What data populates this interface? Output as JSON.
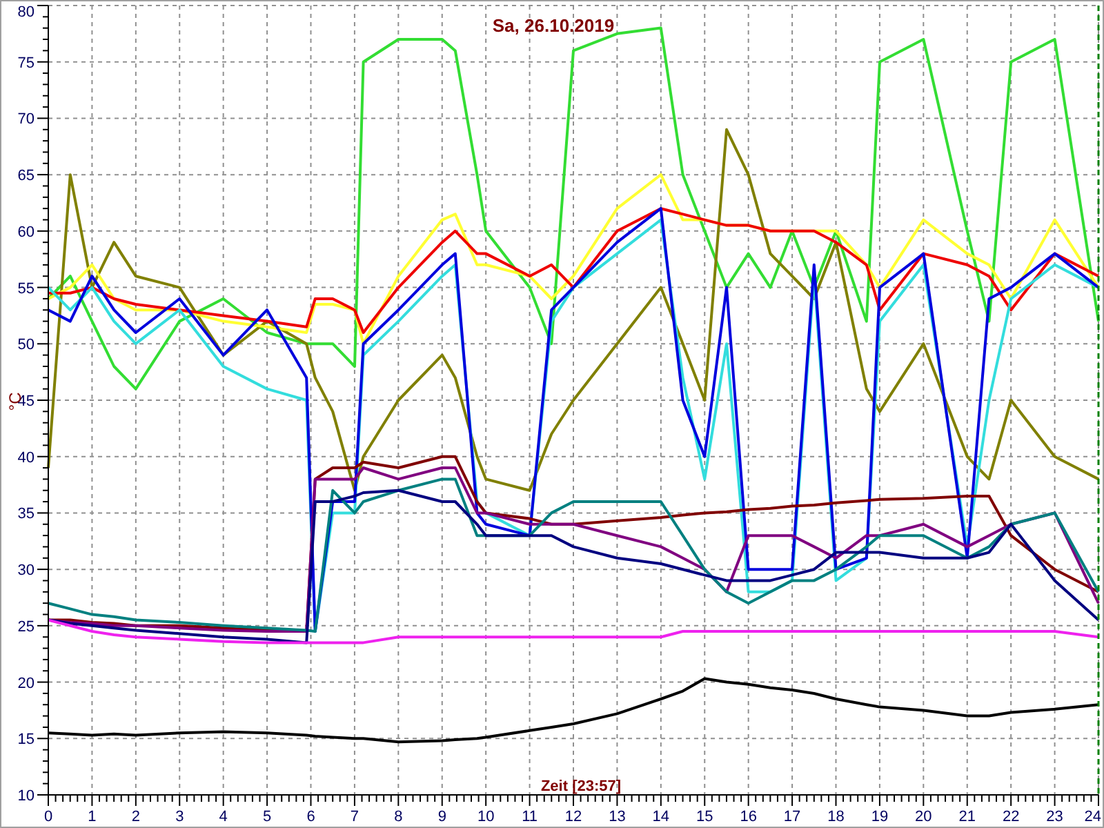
{
  "chart": {
    "chart_data": {
      "type": "line",
      "title": "Sa, 26.10.2019",
      "xlabel": "Zeit [23:57]",
      "ylabel": "°C",
      "x": [
        0,
        0.5,
        1,
        1.5,
        2,
        3,
        4,
        5,
        5.9,
        6.1,
        6.5,
        7,
        7.2,
        8,
        9,
        9.3,
        9.8,
        10,
        11,
        11.5,
        12,
        13,
        14,
        14.5,
        15,
        15.5,
        16,
        16.5,
        17,
        17.5,
        18,
        18.7,
        19,
        20,
        21,
        21.5,
        22,
        23,
        24
      ],
      "grid": true,
      "xlim": [
        0,
        24
      ],
      "ylim": [
        10,
        80
      ],
      "xticks": [
        0,
        1,
        2,
        3,
        4,
        5,
        6,
        7,
        8,
        9,
        10,
        11,
        12,
        13,
        14,
        15,
        16,
        17,
        18,
        19,
        20,
        21,
        22,
        23,
        24
      ],
      "yticks": [
        10,
        15,
        20,
        25,
        30,
        35,
        40,
        45,
        50,
        55,
        60,
        65,
        70,
        75,
        80
      ],
      "series": [
        {
          "color": "#33dd33",
          "values": [
            54,
            56,
            52,
            48,
            46,
            52,
            54,
            51,
            50,
            50,
            50,
            48,
            75,
            77,
            77,
            76,
            65,
            60,
            55,
            50,
            76,
            77.5,
            78,
            65,
            60,
            55,
            58,
            55,
            60,
            55,
            60,
            52,
            75,
            77,
            60,
            52,
            75,
            77,
            52
          ]
        },
        {
          "color": "#808000",
          "values": [
            39,
            65,
            55,
            59,
            56,
            55,
            49,
            52,
            50,
            47,
            44,
            37,
            40,
            45,
            49,
            47,
            40,
            38,
            37,
            42,
            45,
            50,
            55,
            50,
            45,
            69,
            65,
            58,
            56,
            54,
            59,
            46,
            44,
            50,
            40,
            38,
            45,
            40,
            38
          ]
        },
        {
          "color": "#ffff33",
          "values": [
            54,
            55,
            57,
            54,
            53,
            53,
            52,
            51.5,
            51,
            53.5,
            53.5,
            53,
            50,
            56,
            61,
            61.5,
            57,
            57,
            56,
            54,
            56,
            62,
            65,
            61,
            61,
            60.5,
            60.5,
            60,
            60,
            60,
            60,
            57,
            55,
            61,
            58,
            57,
            54,
            61,
            55
          ]
        },
        {
          "color": "#ee0000",
          "values": [
            54.5,
            54.5,
            55,
            54,
            53.5,
            53,
            52.5,
            52,
            51.5,
            54,
            54,
            53,
            51,
            55,
            59,
            60,
            58,
            58,
            56,
            57,
            55,
            60,
            62,
            61.5,
            61,
            60.5,
            60.5,
            60,
            60,
            60,
            59,
            57,
            53,
            58,
            57,
            56,
            53,
            58,
            56
          ]
        },
        {
          "color": "#33dddd",
          "values": [
            55,
            53,
            55,
            52,
            50,
            53,
            48,
            46,
            45,
            24.5,
            35,
            35,
            49,
            52,
            56,
            57,
            36,
            35,
            33,
            52,
            55,
            58,
            61,
            47,
            38,
            50,
            28,
            28,
            29,
            56,
            29,
            31,
            52,
            57,
            32,
            45,
            54,
            57,
            55
          ]
        },
        {
          "color": "#0000dd",
          "values": [
            53,
            52,
            56,
            53,
            51,
            54,
            49,
            53,
            47,
            24.5,
            36,
            36,
            50,
            53,
            57,
            58,
            35,
            34,
            33,
            53,
            55,
            59,
            62,
            45,
            40,
            55,
            30,
            30,
            30,
            57,
            30,
            31,
            55,
            58,
            31,
            54,
            55,
            58,
            55
          ]
        },
        {
          "color": "#800000",
          "values": [
            25.5,
            25.5,
            25.3,
            25.2,
            25,
            25,
            24.8,
            24.6,
            24.5,
            38,
            39,
            39,
            39.5,
            39,
            40,
            40,
            36,
            35,
            34.5,
            34,
            34,
            34.3,
            34.6,
            34.8,
            35,
            35.1,
            35.3,
            35.4,
            35.6,
            35.7,
            35.9,
            36.1,
            36.2,
            36.3,
            36.5,
            36.5,
            33,
            30,
            28
          ]
        },
        {
          "color": "#800080",
          "values": [
            25.5,
            25.3,
            25.2,
            25,
            25,
            24.8,
            24.6,
            24.5,
            24.5,
            38,
            38,
            38,
            39,
            38,
            39,
            39,
            35,
            35,
            34,
            34,
            34,
            33,
            32,
            31,
            30,
            28,
            33,
            33,
            33,
            32,
            31,
            33,
            33,
            34,
            32,
            33,
            34,
            35,
            27
          ]
        },
        {
          "color": "#008080",
          "values": [
            27,
            26.5,
            26,
            25.8,
            25.5,
            25.3,
            25,
            24.8,
            24.6,
            24.5,
            37,
            35,
            36,
            37,
            38,
            38,
            33,
            33,
            33,
            35,
            36,
            36,
            36,
            33,
            30,
            28,
            27,
            28,
            29,
            29,
            30,
            32,
            33,
            33,
            31,
            32,
            34,
            35,
            28
          ]
        },
        {
          "color": "#000080",
          "values": [
            25.5,
            25.2,
            25,
            24.8,
            24.6,
            24.3,
            24,
            23.8,
            23.5,
            36,
            36,
            36.5,
            36.8,
            37,
            36,
            36,
            34,
            33,
            33,
            33,
            32,
            31,
            30.5,
            30,
            29.5,
            29,
            29,
            29,
            29.5,
            30,
            31.5,
            31.5,
            31.5,
            31,
            31,
            31.5,
            34,
            29,
            25.5
          ]
        },
        {
          "color": "#ee22ee",
          "values": [
            25.5,
            25,
            24.5,
            24.2,
            24,
            23.8,
            23.6,
            23.5,
            23.5,
            23.5,
            23.5,
            23.5,
            23.5,
            24,
            24,
            24,
            24,
            24,
            24,
            24,
            24,
            24,
            24,
            24.5,
            24.5,
            24.5,
            24.5,
            24.5,
            24.5,
            24.5,
            24.5,
            24.5,
            24.5,
            24.5,
            24.5,
            24.5,
            24.5,
            24.5,
            24
          ]
        },
        {
          "color": "#000000",
          "values": [
            15.5,
            15.4,
            15.3,
            15.4,
            15.3,
            15.5,
            15.6,
            15.5,
            15.3,
            15.2,
            15.1,
            15,
            15,
            14.7,
            14.8,
            14.9,
            15,
            15.1,
            15.7,
            16,
            16.3,
            17.2,
            18.5,
            19.2,
            20.3,
            20,
            19.8,
            19.5,
            19.3,
            19,
            18.5,
            18,
            17.8,
            17.5,
            17,
            17,
            17.3,
            17.6,
            18
          ]
        }
      ]
    }
  }
}
